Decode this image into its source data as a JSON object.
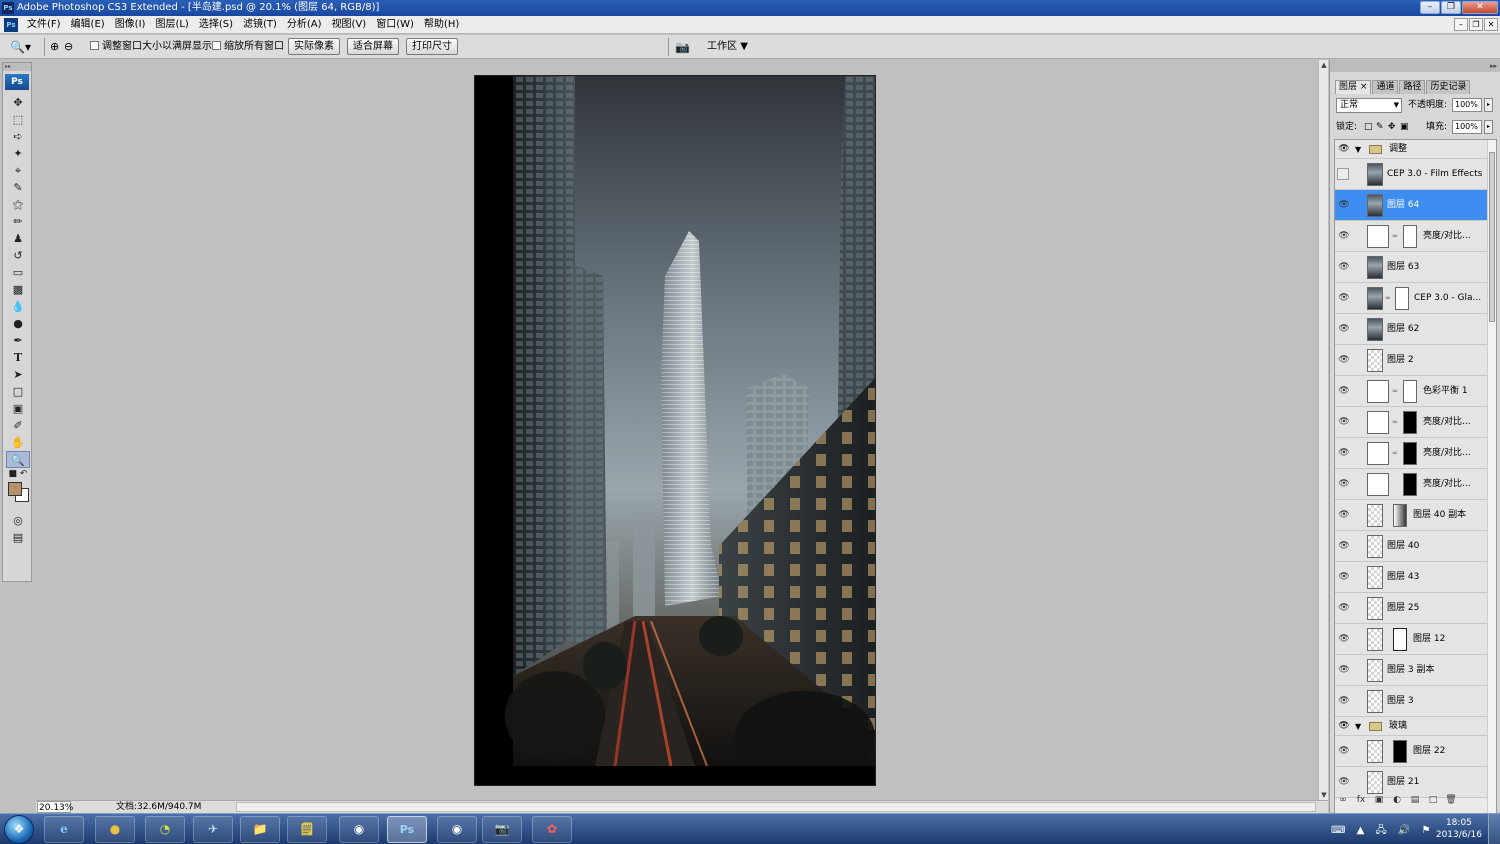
{
  "window": {
    "title": "Adobe Photoshop CS3 Extended - [半岛建.psd @ 20.1% (图层 64, RGB/8)]",
    "app_abbrev": "Ps"
  },
  "menu": [
    "文件(F)",
    "编辑(E)",
    "图像(I)",
    "图层(L)",
    "选择(S)",
    "滤镜(T)",
    "分析(A)",
    "视图(V)",
    "窗口(W)",
    "帮助(H)"
  ],
  "options": {
    "resize_windows": "调整窗口大小以满屏显示",
    "zoom_all": "缩放所有窗口",
    "actual_pixels": "实际像素",
    "fit_screen": "适合屏幕",
    "print_size": "打印尺寸",
    "workspace": "工作区"
  },
  "status": {
    "zoom": "20.13%",
    "doc_info": "文档:32.6M/940.7M"
  },
  "layers_panel": {
    "tabs": [
      "图层",
      "通道",
      "路径",
      "历史记录"
    ],
    "blend_mode": "正常",
    "opacity_label": "不透明度:",
    "opacity": "100%",
    "lock_label": "锁定:",
    "fill_label": "填充:",
    "fill": "100%",
    "groups": {
      "top": "调整",
      "bottom": "玻璃"
    },
    "layers": [
      {
        "name": "CEP 3.0 - Film Effects",
        "visible": false
      },
      {
        "name": "图层 64",
        "visible": true,
        "selected": true
      },
      {
        "name": "亮度/对比...",
        "visible": true
      },
      {
        "name": "图层 63",
        "visible": true
      },
      {
        "name": "CEP 3.0 - Gla...",
        "visible": true
      },
      {
        "name": "图层 62",
        "visible": true
      },
      {
        "name": "图层 2",
        "visible": true
      },
      {
        "name": "色彩平衡 1",
        "visible": true
      },
      {
        "name": "亮度/对比...",
        "visible": true
      },
      {
        "name": "亮度/对比...",
        "visible": true
      },
      {
        "name": "亮度/对比...",
        "visible": true
      },
      {
        "name": "图层 40 副本",
        "visible": true
      },
      {
        "name": "图层 40",
        "visible": true
      },
      {
        "name": "图层 43",
        "visible": true
      },
      {
        "name": "图层 25",
        "visible": true
      },
      {
        "name": "图层 12",
        "visible": true
      },
      {
        "name": "图层 3 副本",
        "visible": true
      },
      {
        "name": "图层 3",
        "visible": true
      },
      {
        "name": "图层 22",
        "visible": true
      },
      {
        "name": "图层 21",
        "visible": true
      }
    ]
  },
  "taskbar": {
    "time": "18:05",
    "date": "2013/6/16"
  }
}
